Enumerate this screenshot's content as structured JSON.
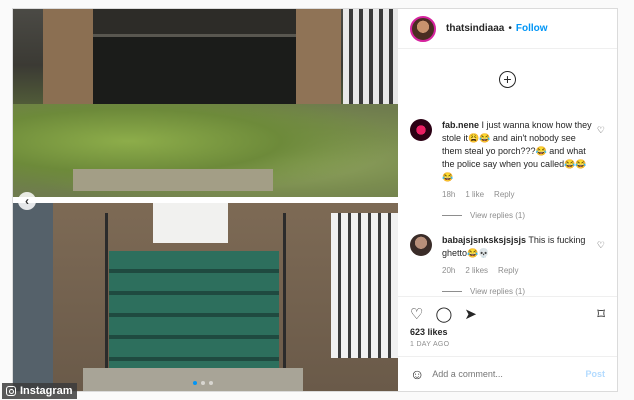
{
  "post": {
    "username": "thatsindiaaa",
    "separator": "•",
    "follow_label": "Follow",
    "add_comment_icon": "plus-circle-icon",
    "comments": [
      {
        "user": "fab.nene",
        "text": "I just wanna know how they stole it😩😂 and ain't nobody see them steal yo porch???😂 and what the police say when you called😂😂😂",
        "age": "18h",
        "likes": "1 like",
        "reply_label": "Reply",
        "view_replies": "View replies (1)"
      },
      {
        "user": "babajsjsnksksjsjsjs",
        "text": "This is fucking ghetto😂💀",
        "age": "20h",
        "likes": "2 likes",
        "reply_label": "Reply",
        "view_replies": "View replies (1)"
      }
    ],
    "likes_count": "623 likes",
    "posted_ago": "1 DAY AGO",
    "add_comment_placeholder": "Add a comment...",
    "post_label": "Post"
  },
  "carousel": {
    "prev_icon": "chevron-left-icon",
    "dot_count": 3,
    "active_index": 0
  },
  "watermark": {
    "label": "Instagram"
  },
  "colors": {
    "follow": "#0095f6",
    "post_disabled": "#b3dbff",
    "muted": "#8e8e8e"
  }
}
